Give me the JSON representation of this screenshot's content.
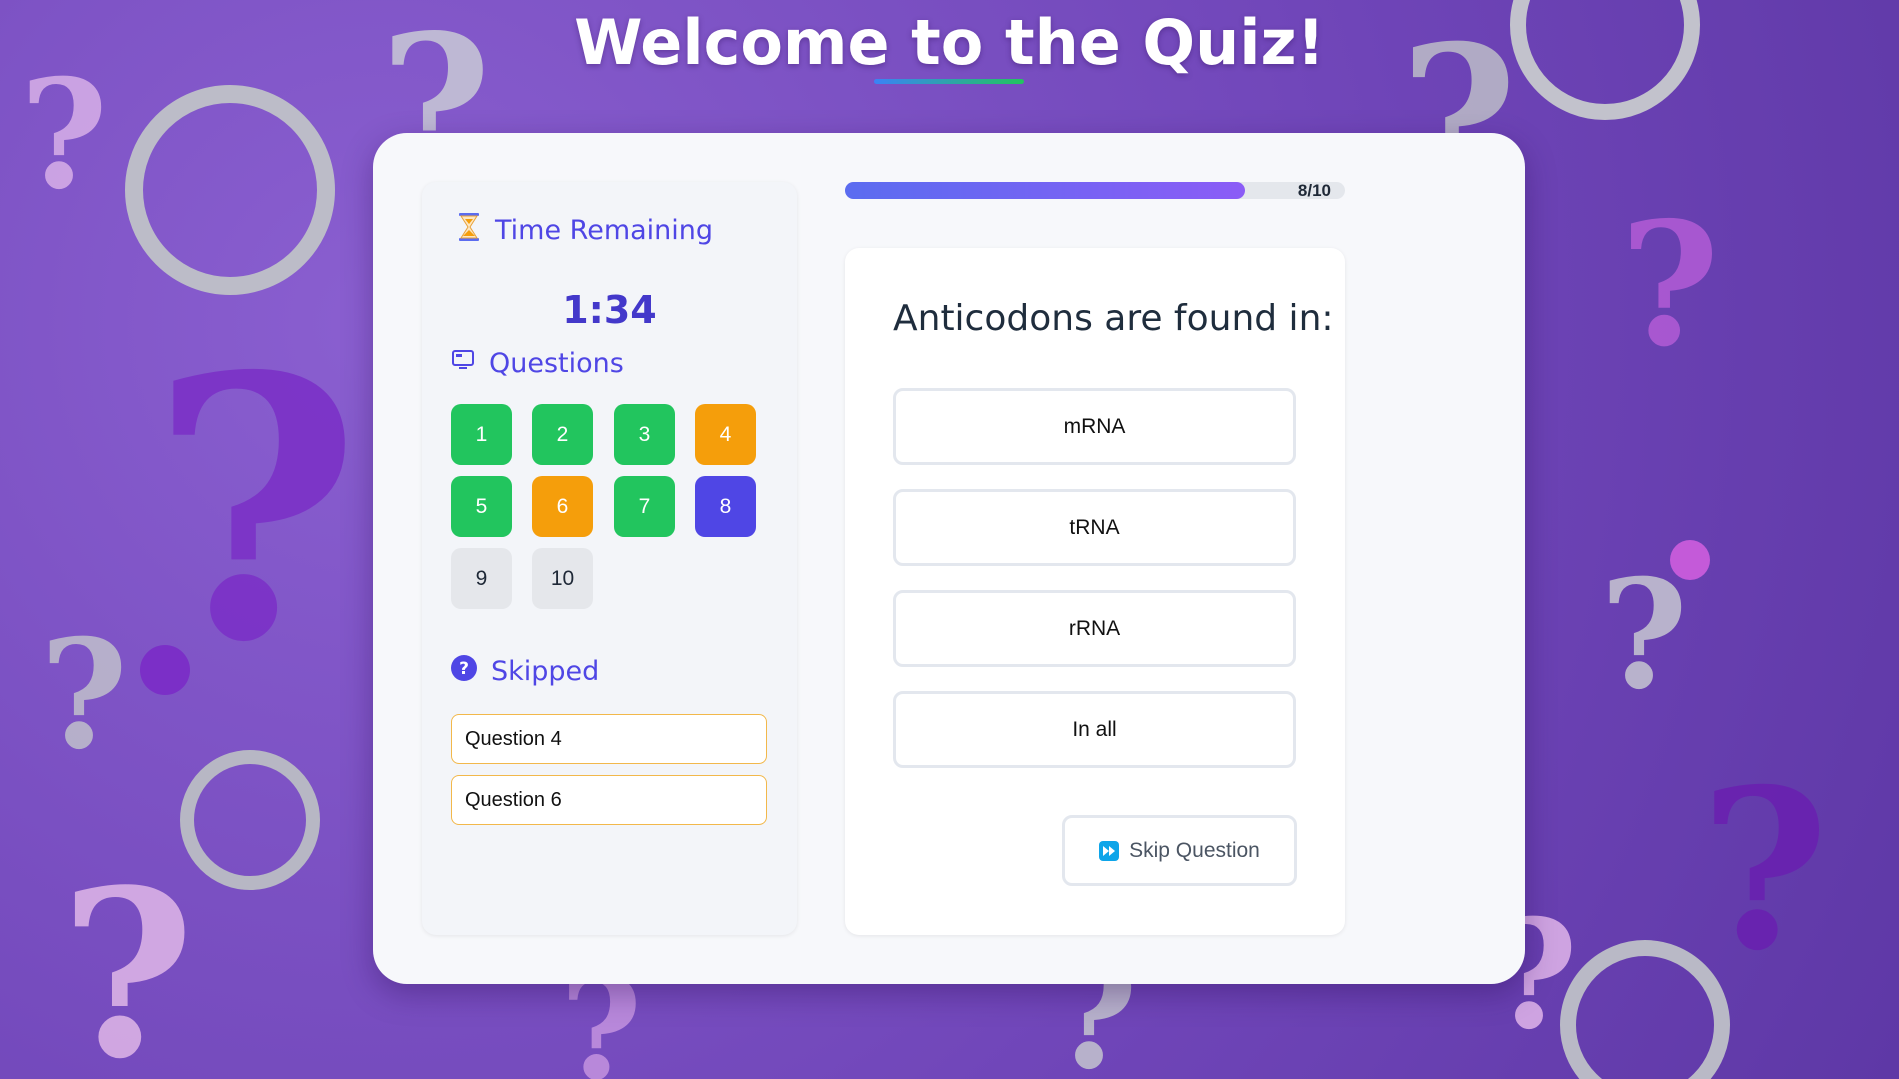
{
  "header": {
    "title": "Welcome to the Quiz!"
  },
  "sidebar": {
    "timer_label": "Time Remaining",
    "timer_icon": "hourglass-icon",
    "timer_value": "1:34",
    "questions_label": "Questions",
    "questions_icon": "monitor-icon",
    "questions": [
      {
        "label": "1",
        "status": "answered"
      },
      {
        "label": "2",
        "status": "answered"
      },
      {
        "label": "3",
        "status": "answered"
      },
      {
        "label": "4",
        "status": "skipped"
      },
      {
        "label": "5",
        "status": "answered"
      },
      {
        "label": "6",
        "status": "skipped"
      },
      {
        "label": "7",
        "status": "answered"
      },
      {
        "label": "8",
        "status": "current"
      },
      {
        "label": "9",
        "status": "unanswered"
      },
      {
        "label": "10",
        "status": "unanswered"
      }
    ],
    "skipped_label": "Skipped",
    "skipped_icon": "question-circle-icon",
    "skipped_items": [
      "Question 4",
      "Question 6"
    ]
  },
  "progress": {
    "text": "8/10",
    "fraction": 0.8
  },
  "question": {
    "text": "Anticodons are found in:",
    "options": [
      "mRNA",
      "tRNA",
      "rRNA",
      "In all"
    ]
  },
  "skip_button": {
    "label": "Skip Question",
    "icon": "fast-forward-icon"
  },
  "colors": {
    "answered": "#22c55e",
    "skipped": "#f59e0b",
    "current": "#4f46e5",
    "unanswered": "#e5e7eb",
    "accent": "#4f46e5"
  }
}
